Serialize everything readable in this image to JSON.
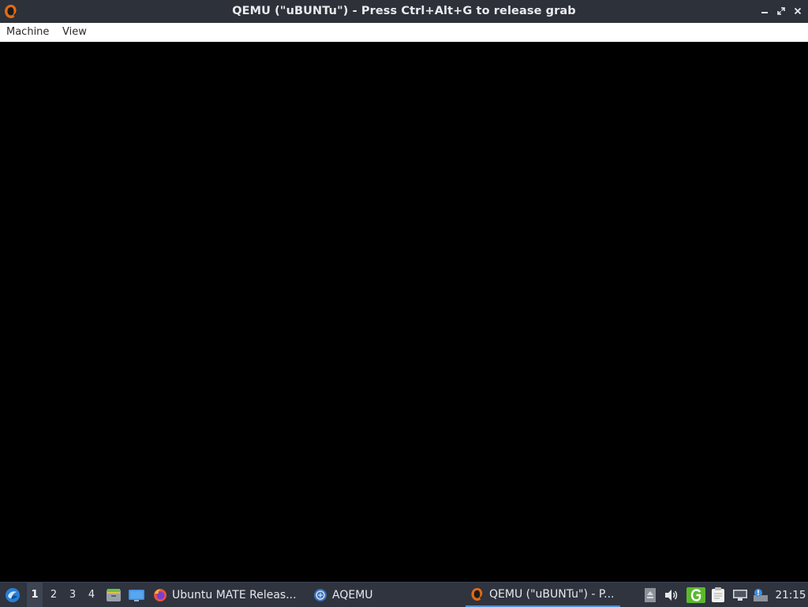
{
  "window": {
    "title": "QEMU (\"uBUNTu\") - Press Ctrl+Alt+G to release grab",
    "icon": "qemu-icon",
    "controls": {
      "minimize": "minimize-icon",
      "restore": "restore-icon",
      "close": "close-icon"
    }
  },
  "menubar": {
    "items": [
      {
        "label": "Machine"
      },
      {
        "label": "View"
      }
    ]
  },
  "taskbar": {
    "start_icon": "lxqt-start-icon",
    "workspaces": [
      {
        "label": "1",
        "active": true
      },
      {
        "label": "2"
      },
      {
        "label": "3"
      },
      {
        "label": "4"
      }
    ],
    "launchers": [
      {
        "icon": "file-manager-icon"
      },
      {
        "icon": "show-desktop-icon"
      }
    ],
    "tasks": [
      {
        "label": "Ubuntu MATE Releas...",
        "icon": "firefox-icon"
      },
      {
        "label": "AQEMU",
        "icon": "aqemu-icon"
      },
      {
        "label": "QEMU (\"uBUNTu\") - P...",
        "icon": "qemu-icon",
        "active": true
      }
    ],
    "tray": [
      {
        "icon": "eject-icon"
      },
      {
        "icon": "volume-icon"
      },
      {
        "icon": "green-g-icon"
      },
      {
        "icon": "clipboard-icon"
      },
      {
        "icon": "network-icon"
      },
      {
        "icon": "update-notifier-icon"
      }
    ],
    "clock": "21:15"
  },
  "colors": {
    "titlebar": "#2d3139",
    "taskbar": "#2f343f",
    "accent": "#4a90d9"
  }
}
